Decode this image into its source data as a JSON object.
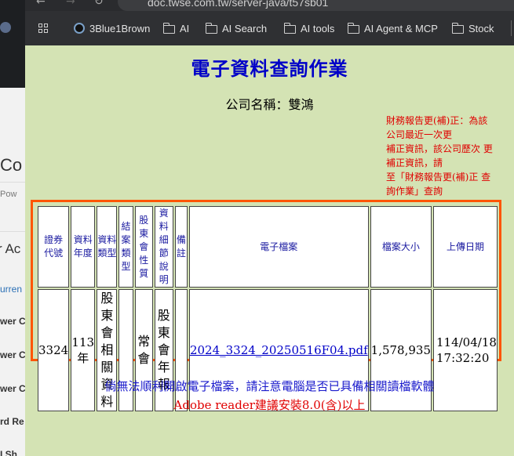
{
  "browser": {
    "url": "doc.twse.com.tw/server-java/t57sb01",
    "bookmarks": [
      "3Blue1Brown",
      "AI",
      "AI Search",
      "AI tools",
      "AI Agent & MCP",
      "Stock"
    ]
  },
  "background_window": {
    "fragments": [
      "Co",
      "Pow",
      "r Ac",
      "urren",
      "wer C",
      "wer C",
      "wer C",
      "rd Re",
      "I Sh"
    ]
  },
  "page": {
    "title": "電子資料查詢作業",
    "company": "公司名稱：雙鴻",
    "note_lines": [
      "財務報告更(補)正：為該",
      "公司最近一次更",
      "補正資訊，該公司歷次 更",
      "補正資訊，請",
      "至「財務報告更(補)正 查",
      "詢作業」查詢"
    ],
    "table": {
      "headers": [
        [
          "證券",
          "代號"
        ],
        [
          "資料",
          "年度"
        ],
        [
          "資料",
          "類型"
        ],
        [
          "結",
          "案",
          "類",
          "型"
        ],
        [
          "股東",
          "會性",
          "質"
        ],
        [
          "資料",
          "細節",
          "說明"
        ],
        [
          "備",
          "註"
        ],
        [
          "電子檔案"
        ],
        [
          "檔案大小"
        ],
        [
          "上傳日期"
        ]
      ],
      "row": {
        "code": "3324",
        "year": [
          "113",
          "年"
        ],
        "type": [
          "股東",
          "會相",
          "關資",
          "料"
        ],
        "case_type": "",
        "meeting_nature": [
          "常",
          "會"
        ],
        "detail": [
          "股",
          "東",
          "會",
          "年",
          "報"
        ],
        "remark": "",
        "file": "2024_3324_20250516F04.pdf",
        "size": "1,578,935",
        "upload": [
          "114/04/18",
          "17:32:20"
        ]
      }
    },
    "warning": "倘無法順利開啟電子檔案，請注意電腦是否已具備相關讀檔軟體",
    "adobe": "Adobe reader建議安裝8.0(含)以上"
  },
  "colors": {
    "page_bg": "#d4e3b4",
    "title": "#0000c8",
    "note": "#e00000",
    "table_border": "#ff5500"
  }
}
